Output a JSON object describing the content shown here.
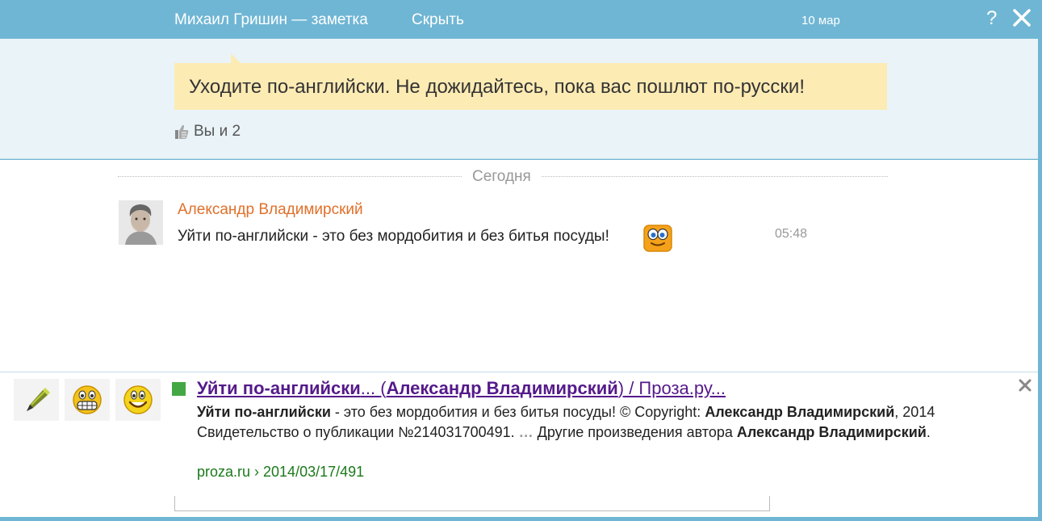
{
  "header": {
    "title": "Михаил Гришин — заметка",
    "hide_label": "Скрыть",
    "date": "10 мар",
    "help_label": "?"
  },
  "note": {
    "text": "Уходите по-английски. Не дожидайтесь, пока вас пошлют по-русски!",
    "likes_text": "Вы и 2"
  },
  "messages": {
    "divider_label": "Сегодня",
    "items": [
      {
        "author": "Александр Владимирский",
        "text": "Уйти по-английски - это без мордобития и без битья посуды!",
        "time": "05:48"
      }
    ]
  },
  "suggestion": {
    "title_part1": "Уйти по-английски",
    "title_part2": "... (",
    "title_part3": "Александр Владимирский",
    "title_part4": ") / Проза.ру...",
    "body_b1": "Уйти по-английски",
    "body_t1": " - это без мордобития и без битья посуды! © Copyright: ",
    "body_b2": "Александр Владимирский",
    "body_t2": ", 2014 Свидетельство о публикации №214031700491. ",
    "body_dots": "…",
    "body_t3": " Другие произведения автора ",
    "body_b3": "Александр Владимирский",
    "body_t4": ".",
    "url": "proza.ru › 2014/03/17/491"
  },
  "colors": {
    "header_bg": "#6fb6d4",
    "note_bg": "#fdebb4",
    "author": "#e0702a",
    "link_visited": "#551a8b",
    "url_green": "#1a7a1a"
  },
  "icons": [
    "close-icon",
    "like-icon",
    "marker-icon",
    "grin-smiley-icon",
    "smile-smiley-icon",
    "suggest-close-icon"
  ]
}
